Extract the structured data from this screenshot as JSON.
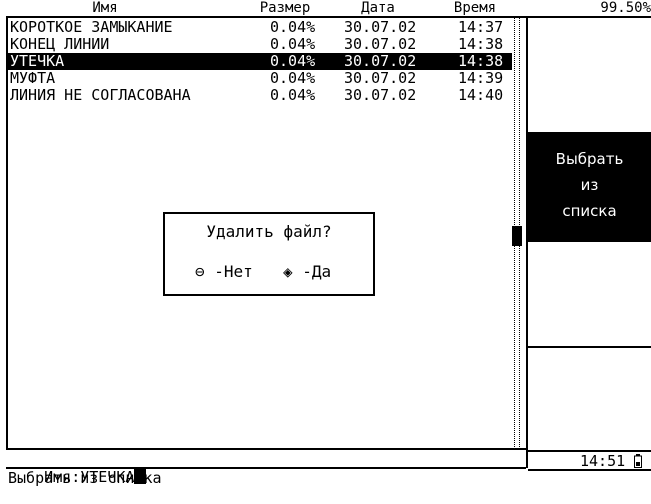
{
  "header": {
    "col_name": "Имя",
    "col_size": "Размер",
    "col_date": "Дата",
    "col_time": "Время",
    "free_space": "99.50%"
  },
  "files": [
    {
      "name": "КОРОТКОЕ ЗАМЫКАНИЕ",
      "size": "0.04%",
      "date": "30.07.02",
      "time": "14:37",
      "selected": false
    },
    {
      "name": "КОНЕЦ ЛИНИИ",
      "size": "0.04%",
      "date": "30.07.02",
      "time": "14:38",
      "selected": false
    },
    {
      "name": "УТЕЧКА",
      "size": "0.04%",
      "date": "30.07.02",
      "time": "14:38",
      "selected": true
    },
    {
      "name": "МУФТА",
      "size": "0.04%",
      "date": "30.07.02",
      "time": "14:39",
      "selected": false
    },
    {
      "name": "ЛИНИЯ НЕ СОГЛАСОВАНА",
      "size": "0.04%",
      "date": "30.07.02",
      "time": "14:40",
      "selected": false
    }
  ],
  "dialog": {
    "title": "Удалить файл?",
    "no_symbol": "⊖",
    "no_label": "-Нет",
    "yes_symbol": "◈",
    "yes_label": "-Да"
  },
  "side_button": {
    "line1": "Выбрать",
    "line2": "из",
    "line3": "списка"
  },
  "name_field": {
    "label": "Имя:",
    "value": "УТЕЧКА"
  },
  "clock": {
    "time": "14:51",
    "battery_icon": "battery-icon"
  },
  "status_line": "Выбрать из списка"
}
